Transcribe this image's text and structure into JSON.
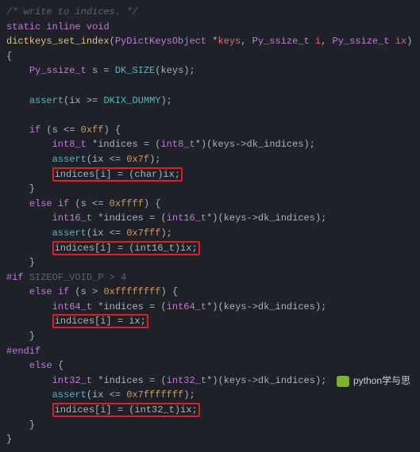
{
  "code": {
    "comment_top": "/* write to indices. */",
    "kw_static": "static",
    "kw_inline": "inline",
    "kw_void": "void",
    "fn_name": "dictkeys_set_index",
    "ty_pdko": "PyDictKeysObject",
    "kw_ptr": "*",
    "p_keys": "keys",
    "ty_pss": "Py_ssize_t",
    "p_i": "i",
    "p_ix": "ix",
    "ty_pss2": "Py_ssize_t",
    "v_s": "s",
    "m_dksize": "DK_SIZE",
    "p_keys2": "keys",
    "m_assert": "assert",
    "v_ix": "ix",
    "c_dkix": "DKIX_DUMMY",
    "kw_if": "if",
    "v_s2": "s",
    "n_0xff": "0xff",
    "ty_int8": "int8_t",
    "v_indices": "indices",
    "ty_int8c": "int8_t",
    "p_keys3": "keys",
    "f_dki": "dk_indices",
    "m_assert2": "assert",
    "v_ix2": "ix",
    "n_0x7f": "0x7f",
    "hl1": "indices[i] = (char)ix;",
    "kw_elseif1": "else if",
    "v_s3": "s",
    "n_0xffff": "0xffff",
    "ty_int16": "int16_t",
    "v_indices2": "indices",
    "ty_int16c": "int16_t",
    "p_keys4": "keys",
    "f_dki2": "dk_indices",
    "m_assert3": "assert",
    "v_ix3": "ix",
    "n_0x7fff": "0x7fff",
    "hl2": "indices[i] = (int16_t)ix;",
    "pp_if": "#if",
    "pp_cond": "SIZEOF_VOID_P > 4",
    "kw_elseif2": "else if",
    "v_s4": "s",
    "n_0xfff8": "0xffffffff",
    "ty_int64": "int64_t",
    "v_indices3": "indices",
    "ty_int64c": "int64_t",
    "p_keys5": "keys",
    "f_dki3": "dk_indices",
    "hl3": "indices[i] = ix;",
    "pp_endif": "#endif",
    "kw_else": "else",
    "ty_int32": "int32_t",
    "v_indices4": "indices",
    "ty_int32c": "int32_t",
    "p_keys6": "keys",
    "f_dki4": "dk_indices",
    "m_assert4": "assert",
    "v_ix4": "ix",
    "n_0x7f8": "0x7fffffff",
    "hl4": "indices[i] = (int32_t)ix;"
  },
  "watermark": "python学与思"
}
